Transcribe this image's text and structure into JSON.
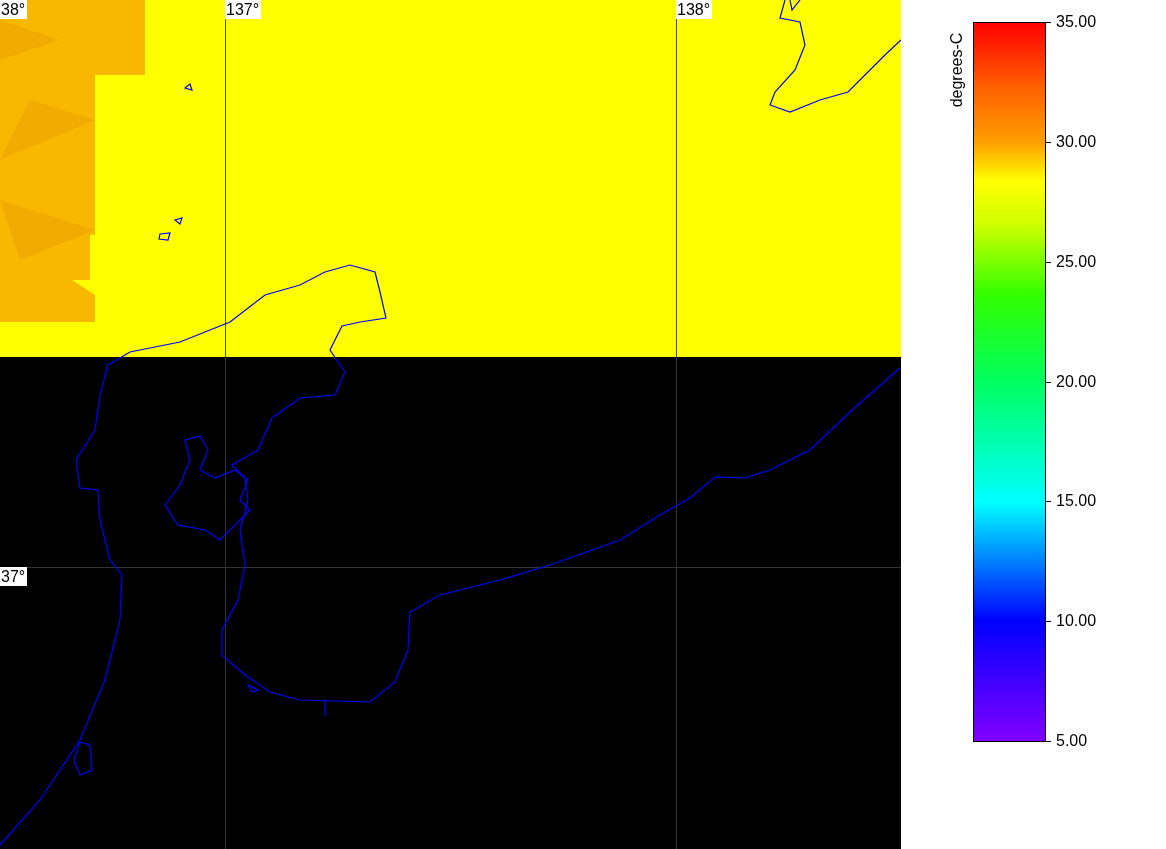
{
  "map": {
    "grid_labels": [
      {
        "text": "38°",
        "kind": "latitude"
      },
      {
        "text": "137°",
        "kind": "longitude"
      },
      {
        "text": "138°",
        "kind": "longitude"
      },
      {
        "text": "37°",
        "kind": "latitude"
      }
    ]
  },
  "colorbar": {
    "title": "degrees-C",
    "ticks": [
      "35.00",
      "30.00",
      "25.00",
      "20.00",
      "15.00",
      "10.00",
      "5.00"
    ]
  }
}
